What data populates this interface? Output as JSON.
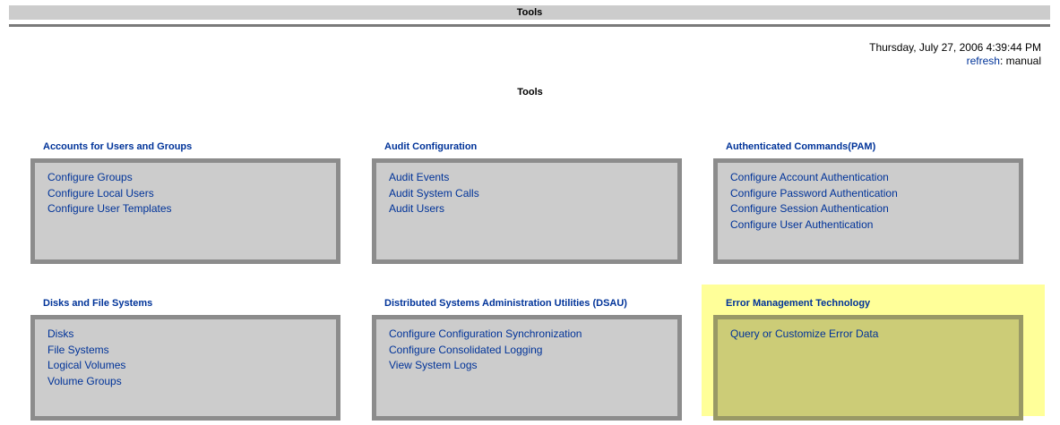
{
  "header": {
    "title": "Tools"
  },
  "timestamp": {
    "datetime": "Thursday, July 27, 2006 4:39:44 PM",
    "refresh_label": "refresh",
    "refresh_value": ": manual"
  },
  "page": {
    "heading": "Tools"
  },
  "sections": [
    {
      "title": "Accounts for Users and Groups",
      "links": [
        "Configure Groups",
        "Configure Local Users",
        "Configure User Templates"
      ]
    },
    {
      "title": "Audit Configuration",
      "links": [
        "Audit Events",
        "Audit System Calls",
        "Audit Users"
      ]
    },
    {
      "title": "Authenticated Commands(PAM)",
      "links": [
        "Configure Account Authentication",
        "Configure Password Authentication",
        "Configure Session Authentication",
        "Configure User Authentication"
      ]
    },
    {
      "title": "Disks and File Systems",
      "links": [
        "Disks",
        "File Systems",
        "Logical Volumes",
        "Volume Groups"
      ]
    },
    {
      "title": "Distributed Systems Administration Utilities (DSAU)",
      "links": [
        "Configure Configuration Synchronization",
        "Configure Consolidated Logging",
        "View System Logs"
      ]
    },
    {
      "title": "Error Management Technology",
      "links": [
        "Query or Customize Error Data"
      ],
      "highlighted": true
    }
  ],
  "colors": {
    "link": "#003399",
    "box_bg": "#cccccc",
    "box_border": "#8c8c8c",
    "highlight": "#ffff99"
  }
}
